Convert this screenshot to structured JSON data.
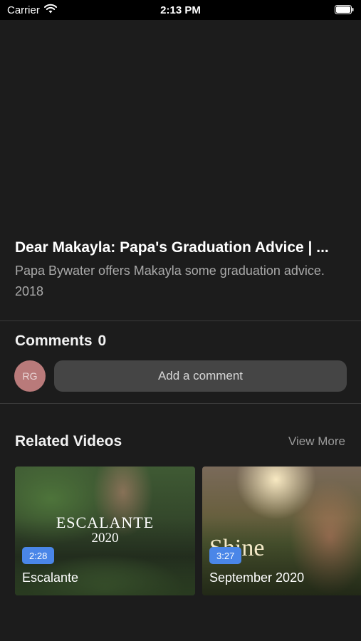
{
  "status_bar": {
    "carrier": "Carrier",
    "time": "2:13 PM"
  },
  "video": {
    "title": "Dear Makayla: Papa's Graduation Advice | ...",
    "description": "Papa Bywater offers Makayla some graduation advice. 2018"
  },
  "comments": {
    "heading": "Comments",
    "count": "0",
    "avatar_initials": "RG",
    "add_label": "Add a comment"
  },
  "related": {
    "heading": "Related Videos",
    "view_more": "View More",
    "items": [
      {
        "title": "Escalante",
        "duration": "2:28",
        "thumb_line1": "ESCALANTE",
        "thumb_line2": "2020"
      },
      {
        "title": "September 2020",
        "duration": "3:27",
        "thumb_line1": "Shine"
      }
    ]
  },
  "colors": {
    "background": "#1c1c1c",
    "accent_badge": "#4a86e8",
    "avatar": "#b97a7a",
    "comment_field": "#454545"
  }
}
